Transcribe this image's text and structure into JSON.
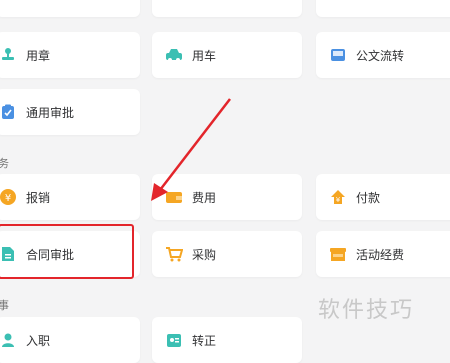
{
  "sections": {
    "finance": "务",
    "hr": "事"
  },
  "cards": {
    "seal": "用章",
    "car": "用车",
    "doc_flow": "公文流转",
    "general_approval": "通用审批",
    "reimburse": "报销",
    "expense": "费用",
    "payment": "付款",
    "contract_approval": "合同审批",
    "purchase": "采购",
    "activity_fee": "活动经费",
    "onboard": "入职",
    "regularize": "转正"
  },
  "watermark": "软件技巧",
  "colors": {
    "highlight": "#e3252b",
    "teal": "#3bbfb3",
    "orange": "#f5a623",
    "blue": "#4a90e2"
  }
}
